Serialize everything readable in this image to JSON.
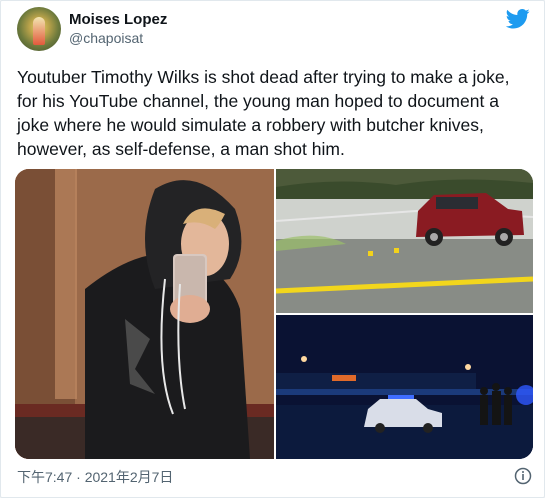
{
  "user": {
    "name": "Moises Lopez",
    "handle": "@chapoisat"
  },
  "tweet": {
    "text": "Youtuber Timothy Wilks is shot dead after trying to make a joke, for his YouTube channel, the young man hoped to document a joke where he would simulate a robbery with butcher knives, however, as self-defense, a man shot him.",
    "timestamp": "下午7:47 · 2021年2月7日"
  },
  "icons": {
    "brand": "twitter-bird-icon",
    "info": "info-icon"
  },
  "colors": {
    "brand": "#1d9bf0",
    "text": "#0f1419",
    "muted": "#536471"
  }
}
